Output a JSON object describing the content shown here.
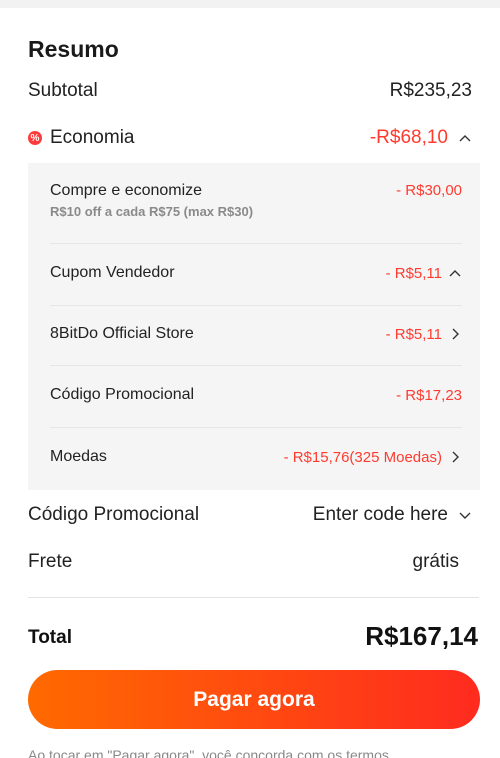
{
  "summary": {
    "title": "Resumo",
    "subtotal_label": "Subtotal",
    "subtotal_value": "R$235,23",
    "economy_label": "Economia",
    "economy_badge": "%",
    "economy_value": "-R$68,10"
  },
  "discounts": [
    {
      "label": "Compre e economize",
      "hint": "R$10 off a cada R$75 (max R$30)",
      "value": "- R$30,00"
    },
    {
      "label": "Cupom Vendedor",
      "value": "- R$5,11"
    },
    {
      "label": "8BitDo Official Store",
      "value": "- R$5,11"
    },
    {
      "label": "Código Promocional",
      "value": "- R$17,23"
    },
    {
      "label": "Moedas",
      "value": "- R$15,76(325 Moedas)"
    }
  ],
  "promo": {
    "label": "Código Promocional",
    "placeholder": "Enter code here"
  },
  "shipping": {
    "label": "Frete",
    "value": "grátis"
  },
  "total": {
    "label": "Total",
    "value": "R$167,14"
  },
  "pay_button": "Pagar agora",
  "footer_cut_text": "Ao tocar em \"Pagar agora\", você concorda com os termos"
}
